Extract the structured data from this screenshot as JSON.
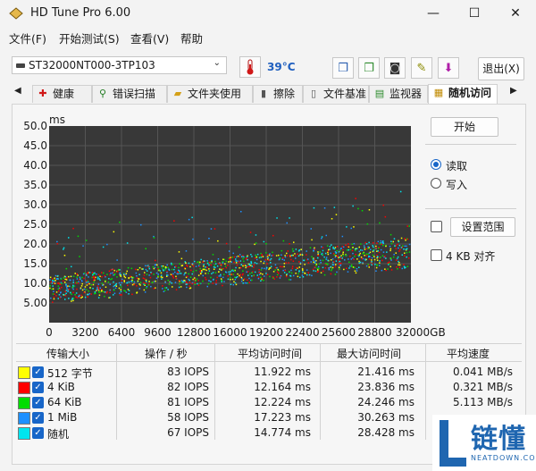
{
  "window": {
    "title": "HD Tune Pro 6.00",
    "min": "—",
    "max": "☐",
    "close": "✕"
  },
  "menu": [
    "文件(F)",
    "开始测试(S)",
    "查看(V)",
    "帮助"
  ],
  "toolbar": {
    "drive": "ST32000NT000-3TP103",
    "temperature": "39°C",
    "exit": "退出(X)",
    "icons": [
      "copy-icon",
      "copy-info-icon",
      "camera-icon",
      "wand-icon",
      "save-icon"
    ]
  },
  "tabs": [
    "健康",
    "错误扫描",
    "文件夹使用",
    "擦除",
    "文件基准",
    "监视器",
    "随机访问"
  ],
  "active_tab": "随机访问",
  "controls": {
    "start": "开始",
    "read": "读取",
    "write": "写入",
    "range": "设置范围",
    "kb4": "4 KB 对齐"
  },
  "chart_data": {
    "type": "scatter",
    "y_unit_label": "ms",
    "ylim": [
      0,
      50
    ],
    "y_ticks": [
      "50.0",
      "45.0",
      "40.0",
      "35.0",
      "30.0",
      "25.0",
      "20.0",
      "15.0",
      "10.0",
      "5.00"
    ],
    "xlim": [
      0,
      32000
    ],
    "x_ticks": [
      "0",
      "3200",
      "6400",
      "9600",
      "12800",
      "16000",
      "19200",
      "22400",
      "25600",
      "28800",
      "32000GB"
    ],
    "series": [
      {
        "name": "512 字节",
        "color": "#ffff00"
      },
      {
        "name": "4 KiB",
        "color": "#ff0000"
      },
      {
        "name": "64 KiB",
        "color": "#00dd00"
      },
      {
        "name": "1 MiB",
        "color": "#1e90ff"
      },
      {
        "name": "随机",
        "color": "#00e5ee"
      }
    ],
    "trend_ms": {
      "at_0GB": [
        5,
        12
      ],
      "at_32000GB": [
        14,
        22
      ]
    },
    "grid": true
  },
  "table": {
    "headers": [
      "传输大小",
      "操作 / 秒",
      "平均访问时间",
      "最大访问时间",
      "平均速度"
    ],
    "rows": [
      {
        "size": "512 字节",
        "ops": "83 IOPS",
        "avg": "11.922 ms",
        "max": "21.416 ms",
        "speed": "0.041 MB/s",
        "color": "#ffff00"
      },
      {
        "size": "4 KiB",
        "ops": "82 IOPS",
        "avg": "12.164 ms",
        "max": "23.836 ms",
        "speed": "0.321 MB/s",
        "color": "#ff0000"
      },
      {
        "size": "64 KiB",
        "ops": "81 IOPS",
        "avg": "12.224 ms",
        "max": "24.246 ms",
        "speed": "5.113 MB/s",
        "color": "#00dd00"
      },
      {
        "size": "1 MiB",
        "ops": "58 IOPS",
        "avg": "17.223 ms",
        "max": "30.263 ms",
        "speed": "",
        "color": "#1e90ff"
      },
      {
        "size": "随机",
        "ops": "67 IOPS",
        "avg": "14.774 ms",
        "max": "28.428 ms",
        "speed": "",
        "color": "#00e5ee"
      }
    ]
  },
  "watermark": {
    "text": "链懂",
    "sub": "NEATDOWN.COM"
  }
}
